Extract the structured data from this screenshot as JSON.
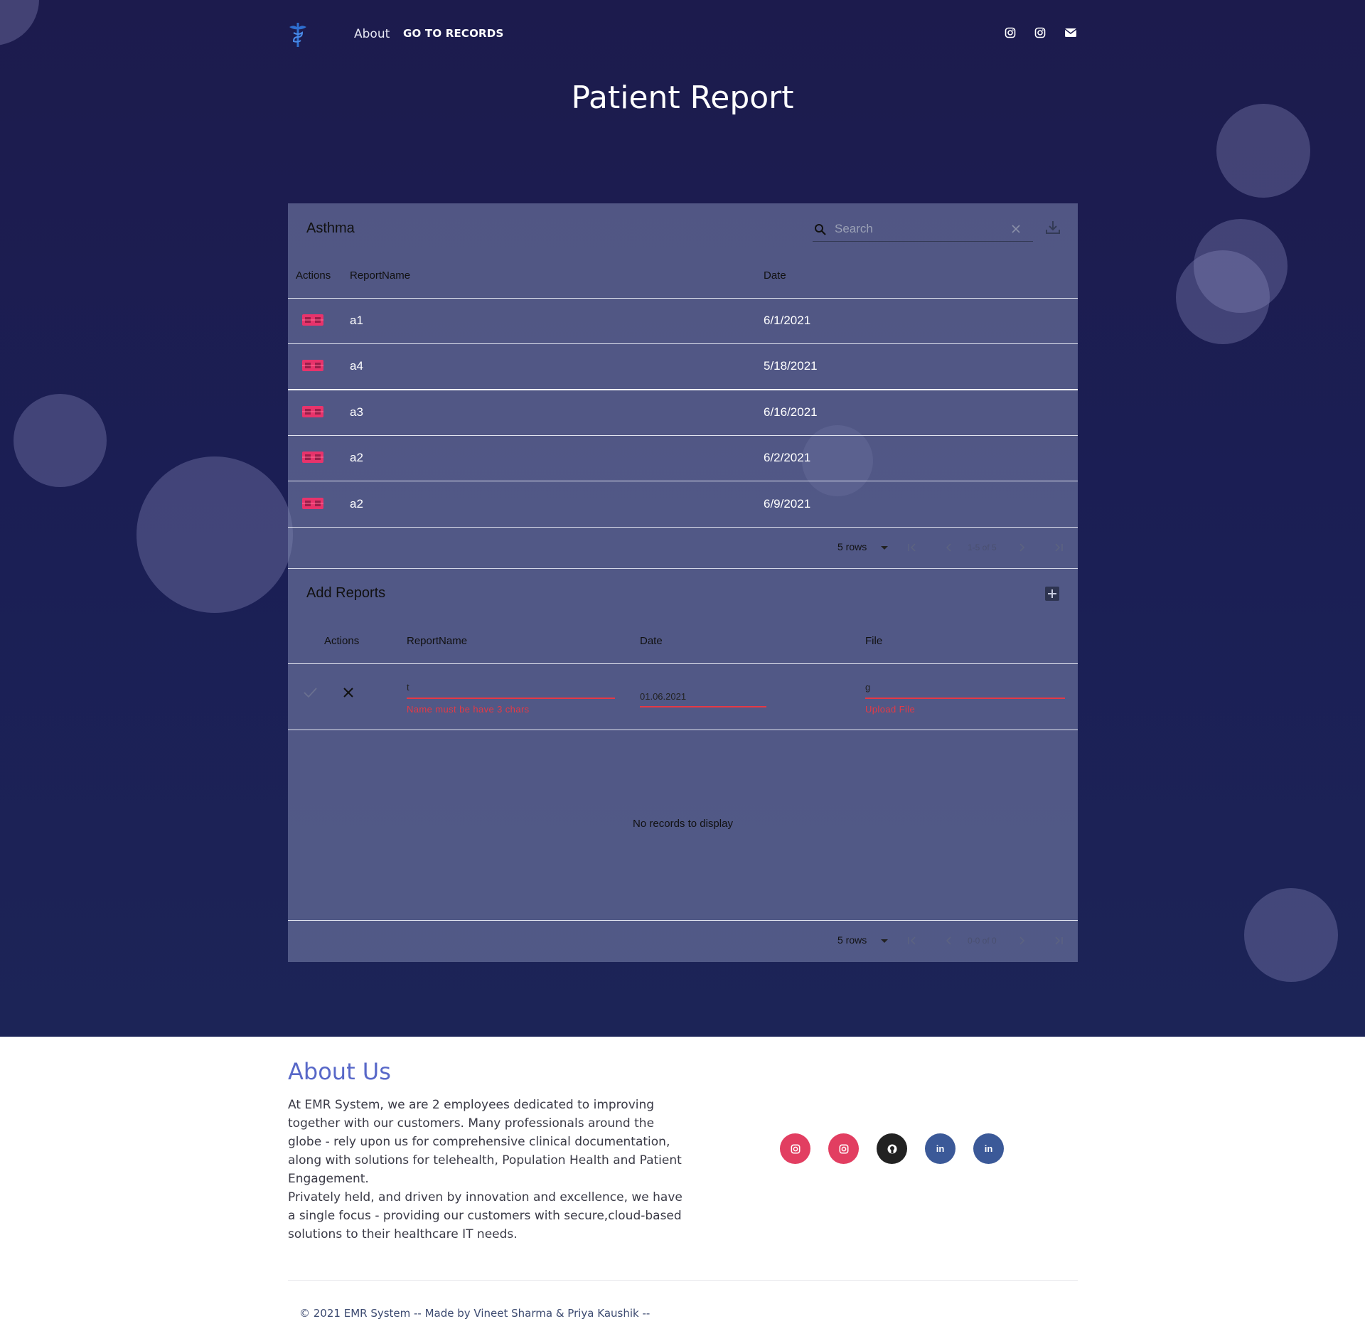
{
  "nav": {
    "about": "About",
    "records": "GO TO RECORDS",
    "icons": [
      "instagram-icon",
      "instagram-icon",
      "mail-icon"
    ]
  },
  "page_title": "Patient Report",
  "reports_table": {
    "title": "Asthma",
    "search_placeholder": "Search",
    "columns": [
      "Actions",
      "ReportName",
      "Date"
    ],
    "rows": [
      {
        "name": "a1",
        "date": "6/1/2021"
      },
      {
        "name": "a4",
        "date": "5/18/2021"
      },
      {
        "name": "a3",
        "date": "6/16/2021"
      },
      {
        "name": "a2",
        "date": "6/2/2021"
      },
      {
        "name": "a2",
        "date": "6/9/2021"
      }
    ],
    "pager": {
      "rows": "5 rows",
      "info": "1-5 of 5"
    }
  },
  "add_table": {
    "title": "Add Reports",
    "columns": [
      "Actions",
      "ReportName",
      "Date",
      "File"
    ],
    "edit_row": {
      "name_value": "t",
      "name_error": "Name must be have 3 chars",
      "date_value": "01.06.2021",
      "file_value": "g",
      "file_error": "Upload File"
    },
    "empty_message": "No records to display",
    "pager": {
      "rows": "5 rows",
      "info": "0-0 of 0"
    }
  },
  "about": {
    "title": "About Us",
    "paragraph1": "At EMR System, we are 2 employees dedicated to improving together with our customers. Many professionals around the globe - rely upon us for comprehensive clinical documentation, along with solutions for telehealth, Population Health and Patient Engagement.",
    "paragraph2": "Privately held, and driven by innovation and excellence, we have a single focus - providing our customers with secure,cloud-based solutions to their healthcare IT needs."
  },
  "socials": [
    {
      "icon": "instagram-icon",
      "color": "#e23e61"
    },
    {
      "icon": "instagram-icon",
      "color": "#e23e61"
    },
    {
      "icon": "github-icon",
      "color": "#222222",
      "glyph": "⊙"
    },
    {
      "icon": "linkedin-icon",
      "color": "#3b5998",
      "glyph": "in"
    },
    {
      "icon": "linkedin-icon",
      "color": "#3b5998",
      "glyph": "in"
    }
  ],
  "footer": "© 2021 EMR System -- Made by Vineet Sharma & Priya Kaushik --"
}
